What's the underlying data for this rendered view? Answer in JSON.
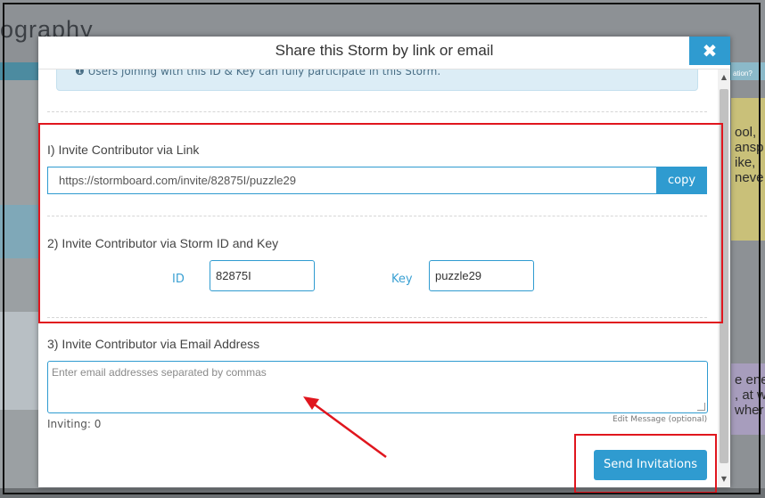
{
  "background": {
    "title_fragment": "ography",
    "right_notes": [
      {
        "text": "ool,\nansp\nike,\nneve"
      },
      {
        "text": "e ene\n, at w\nwher"
      }
    ],
    "small_tag": "ation?"
  },
  "modal": {
    "title": "Share this Storm by link or email",
    "close_label": "✖",
    "info_text": "❶ Users joining with this ID & Key can fully participate in this Storm.",
    "section1": {
      "label": "I) Invite Contributor via Link",
      "link": "https://stormboard.com/invite/82875I/puzzle29",
      "copy_label": "copy"
    },
    "section2": {
      "label": "2) Invite Contributor via Storm ID and Key",
      "id_label": "ID",
      "id_value": "82875I",
      "key_label": "Key",
      "key_value": "puzzle29"
    },
    "section3": {
      "label": "3) Invite Contributor via Email Address",
      "email_placeholder": "Enter email addresses separated by commas",
      "inviting_label": "Inviting: 0",
      "edit_message_label": "Edit Message (optional)",
      "send_label": "Send Invitations"
    }
  },
  "colors": {
    "accent": "#2f9bd0",
    "annotation_red": "#e0161e",
    "info_bg": "#dcedf6"
  }
}
